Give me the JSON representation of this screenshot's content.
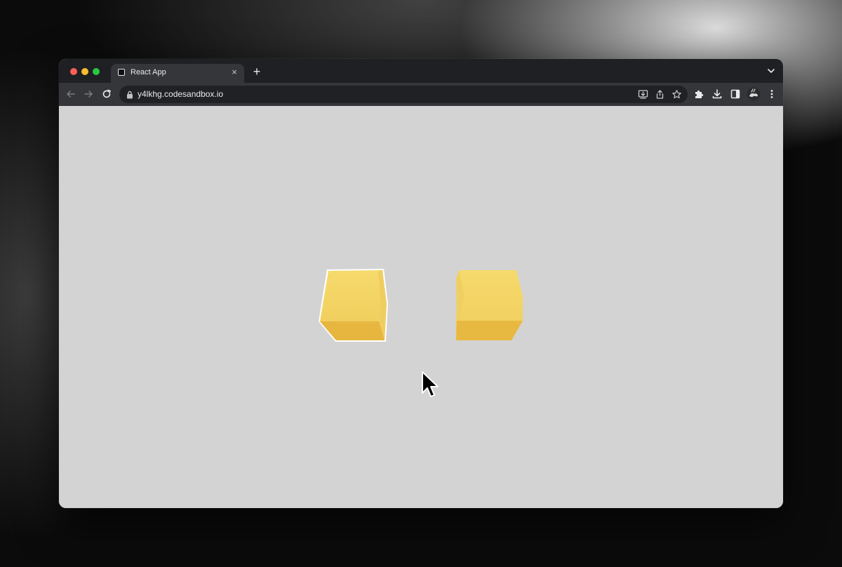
{
  "browser": {
    "tab": {
      "title": "React App",
      "close_glyph": "×",
      "favicon": "codesandbox-icon"
    },
    "new_tab_glyph": "+",
    "address_bar": {
      "url": "y4lkhg.codesandbox.io",
      "secure": true
    },
    "icons": {
      "back": "arrow-left-icon",
      "forward": "arrow-right-icon",
      "reload": "reload-icon",
      "install": "install-app-icon",
      "share": "share-icon",
      "bookmark": "star-icon",
      "extensions": "puzzle-icon",
      "downloads": "download-icon",
      "side_panel": "side-panel-icon",
      "profile": "avatar",
      "menu": "kebab-menu-icon",
      "tab_search": "chevron-down-icon"
    }
  },
  "scene": {
    "background_color": "#d3d3d3",
    "cubes": [
      {
        "name": "left-cube",
        "color": "#f2cf5b",
        "hovered": true
      },
      {
        "name": "right-cube",
        "color": "#f2cf5b",
        "hovered": false
      }
    ]
  },
  "colors": {
    "titlebar": "#1f2023",
    "toolbar": "#35363a",
    "omnibox": "#202124",
    "cube_top": "#f5d86a",
    "cube_side": "#e9b93f",
    "cube_bottom": "#e2b038",
    "hover_outline": "#ffffff"
  }
}
